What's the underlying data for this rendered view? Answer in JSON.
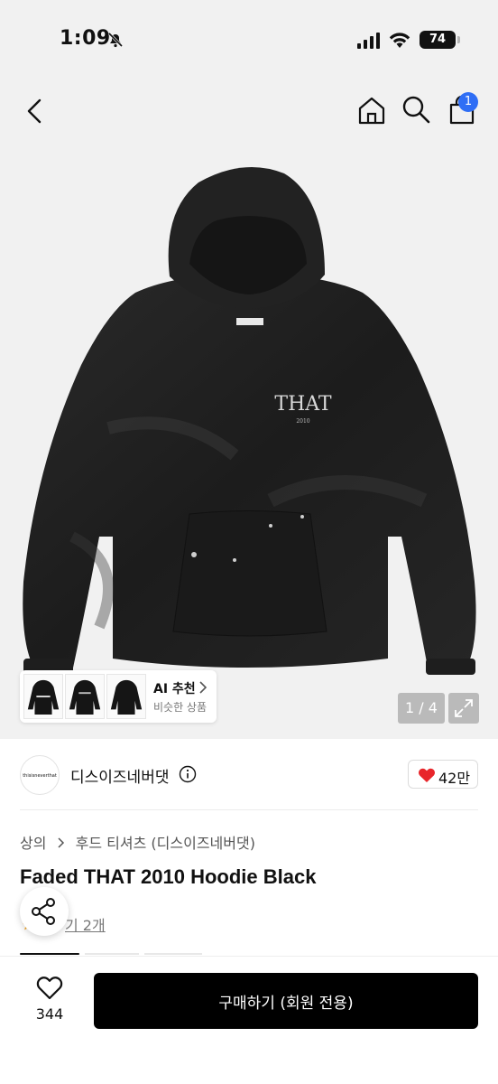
{
  "status_bar": {
    "time": "1:09",
    "battery": "74"
  },
  "header": {
    "cart_count": "1"
  },
  "hero": {
    "ai_recommend": {
      "title": "AI 추천",
      "subtitle": "비슷한 상품"
    },
    "page_indicator": "1 / 4"
  },
  "brand": {
    "logo_text": "thisisneverthat",
    "name": "디스이즈네버댓",
    "likes": "42만"
  },
  "breadcrumb": {
    "level1": "상의",
    "level2": "후드 티셔츠 (디스이즈네버댓)"
  },
  "product": {
    "title": "Faded THAT 2010 Hoodie Black",
    "reviews_link": "기 2개"
  },
  "bottom_bar": {
    "wish_count": "344",
    "buy_label": "구매하기 (회원 전용)"
  },
  "colors": {
    "accent_badge": "#2f6ef5",
    "heart": "#e8262b",
    "buy_button": "#000000"
  },
  "icons": [
    "back-arrow-icon",
    "home-icon",
    "search-icon",
    "cart-icon",
    "info-icon",
    "heart-icon",
    "share-icon",
    "expand-icon",
    "bell-off-icon",
    "signal-icon",
    "wifi-icon"
  ]
}
